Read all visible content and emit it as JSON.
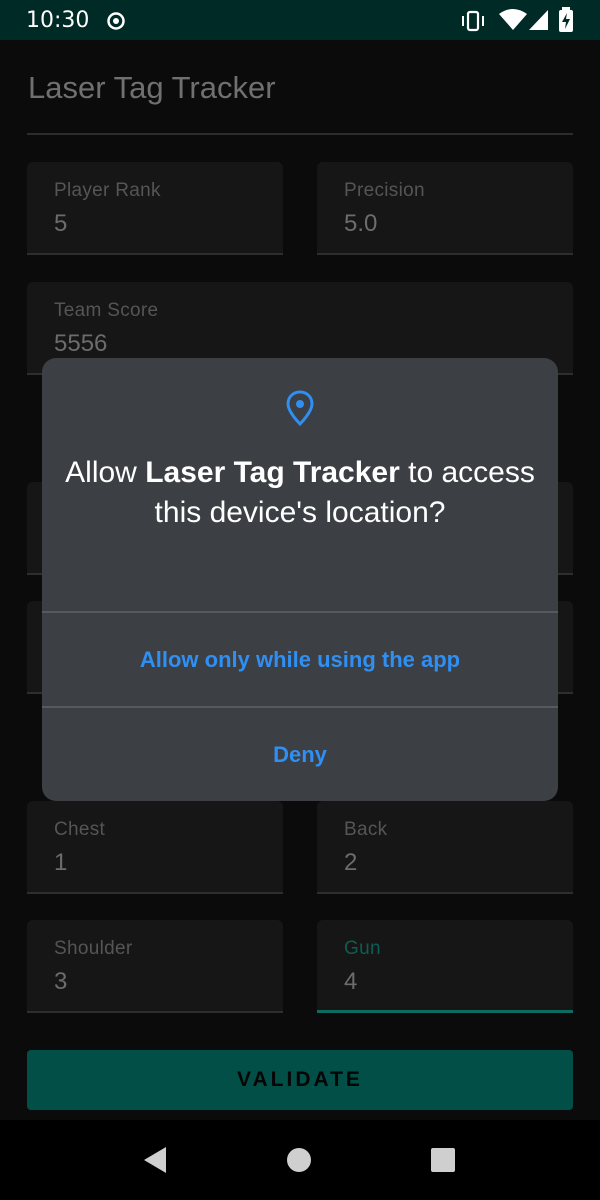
{
  "status_bar": {
    "time": "10:30"
  },
  "app": {
    "title": "Laser Tag Tracker"
  },
  "fields": {
    "player_rank": {
      "label": "Player Rank",
      "value": "5"
    },
    "precision": {
      "label": "Precision",
      "value": "5.0"
    },
    "team_score": {
      "label": "Team Score",
      "value": "5556"
    },
    "chest": {
      "label": "Chest",
      "value": "1"
    },
    "back": {
      "label": "Back",
      "value": "2"
    },
    "shoulder": {
      "label": "Shoulder",
      "value": "3"
    },
    "gun": {
      "label": "Gun",
      "value": "4"
    }
  },
  "validate_button": {
    "label": "VALIDATE"
  },
  "dialog": {
    "icon": "location-pin-icon",
    "message_prefix": "Allow ",
    "message_app": "Laser Tag Tracker",
    "message_suffix": " to access this device's location?",
    "allow_label": "Allow only while using the app",
    "deny_label": "Deny"
  },
  "colors": {
    "accent": "#2f8ff3",
    "status_bar": "#002a26",
    "button": "#014f46",
    "focused_field": "#0e6b5f",
    "dialog_bg": "#3c3f43"
  }
}
